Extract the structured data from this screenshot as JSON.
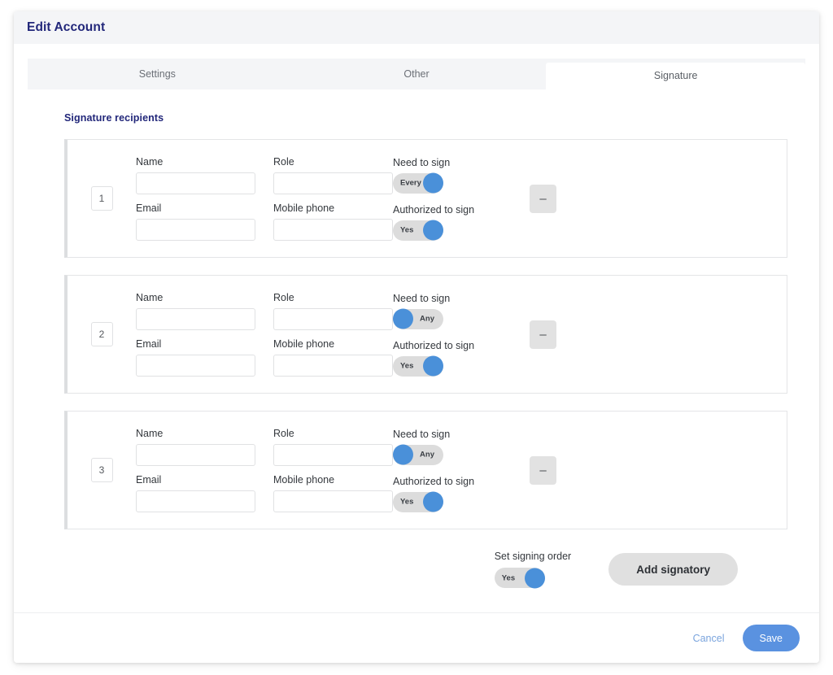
{
  "window": {
    "title": "Edit Account"
  },
  "tabs": [
    {
      "id": "settings",
      "label": "Settings",
      "active": false
    },
    {
      "id": "other",
      "label": "Other",
      "active": false
    },
    {
      "id": "signature",
      "label": "Signature",
      "active": true
    }
  ],
  "section": {
    "title": "Signature recipients"
  },
  "field_labels": {
    "name": "Name",
    "role": "Role",
    "email": "Email",
    "mobile_phone": "Mobile phone"
  },
  "toggle_labels": {
    "need_to_sign": "Need to sign",
    "authorized_to_sign": "Authorized to sign",
    "set_signing_order": "Set signing order"
  },
  "recipients": [
    {
      "index": "1",
      "name": "",
      "role": "",
      "email": "",
      "mobile_phone": "",
      "need_to_sign": {
        "value": "Every",
        "knob": "right"
      },
      "authorized_to_sign": {
        "value": "Yes",
        "knob": "right"
      },
      "remove_label": "–"
    },
    {
      "index": "2",
      "name": "",
      "role": "",
      "email": "",
      "mobile_phone": "",
      "need_to_sign": {
        "value": "Any",
        "knob": "left"
      },
      "authorized_to_sign": {
        "value": "Yes",
        "knob": "right"
      },
      "remove_label": "–"
    },
    {
      "index": "3",
      "name": "",
      "role": "",
      "email": "",
      "mobile_phone": "",
      "need_to_sign": {
        "value": "Any",
        "knob": "left"
      },
      "authorized_to_sign": {
        "value": "Yes",
        "knob": "right"
      },
      "remove_label": "–"
    }
  ],
  "signing_order": {
    "label": "Set signing order",
    "value": "Yes",
    "knob": "right"
  },
  "add_signatory": {
    "label": "Add signatory"
  },
  "actions": {
    "cancel_label": "Cancel",
    "save_label": "Save"
  },
  "colors": {
    "title_navy": "#22277a",
    "accent_blue": "#4a90d9",
    "save_blue": "#5a92e0",
    "cancel_blue": "#7aa4dd",
    "header_grey": "#f4f5f7",
    "toggle_track": "#dcdcdc",
    "button_grey": "#e0e0e0",
    "card_border": "#e4e5e7",
    "card_accent_border": "#dcdee0"
  }
}
